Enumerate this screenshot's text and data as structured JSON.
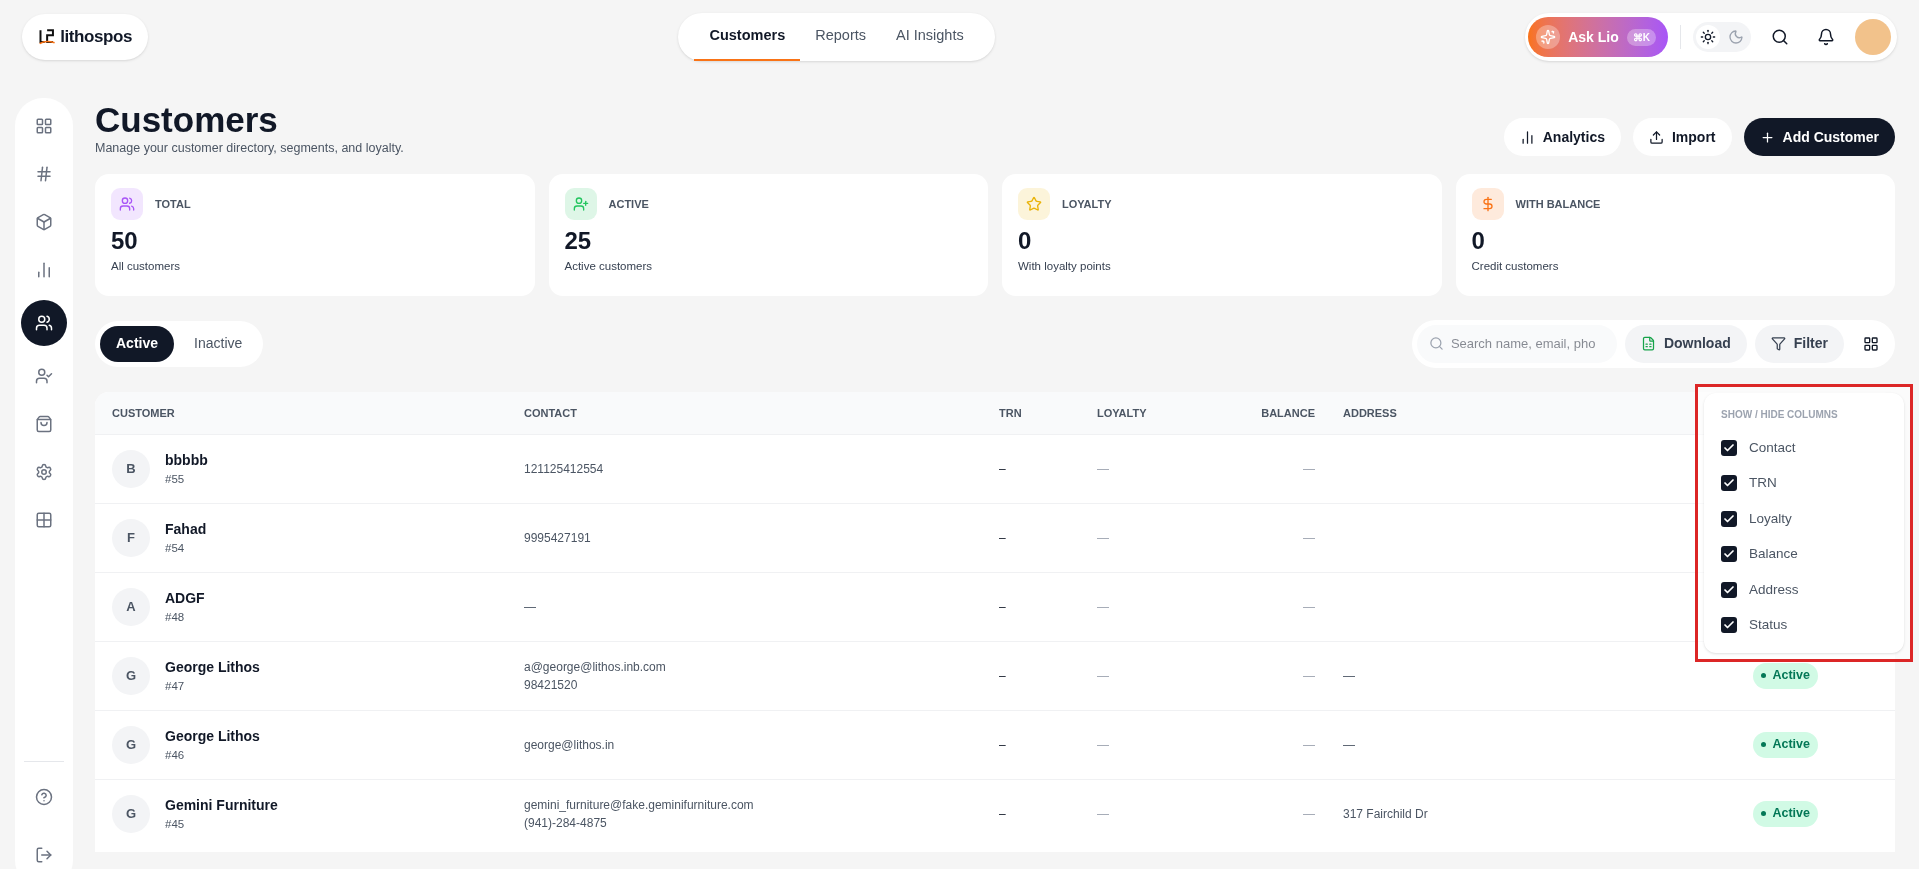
{
  "brand": {
    "name": "lithospos"
  },
  "nav": [
    {
      "label": "Customers",
      "selected": true
    },
    {
      "label": "Reports",
      "selected": false
    },
    {
      "label": "AI Insights",
      "selected": false
    }
  ],
  "assistant": {
    "label": "Ask Lio",
    "shortcut": "⌘K"
  },
  "theme": {
    "dark": false
  },
  "sidebar": {
    "items": [
      {
        "selected": false
      },
      {
        "selected": false
      },
      {
        "selected": false
      },
      {
        "selected": false
      },
      {
        "selected": true
      },
      {
        "selected": false
      },
      {
        "selected": false
      },
      {
        "selected": false
      },
      {
        "selected": false
      }
    ],
    "footer": [
      {
        "selected": false
      },
      {
        "selected": false
      }
    ]
  },
  "page": {
    "title": "Customers",
    "subtitle": "Manage your customer directory, segments, and loyalty.",
    "actions": [
      {
        "label": "Analytics",
        "kind": "secondary"
      },
      {
        "label": "Import",
        "kind": "secondary"
      },
      {
        "label": "Add Customer",
        "kind": "primary"
      }
    ]
  },
  "stats": [
    {
      "label": "TOTAL",
      "value": "50",
      "caption": "All customers",
      "color": "#a855f7"
    },
    {
      "label": "ACTIVE",
      "value": "25",
      "caption": "Active customers",
      "color": "#22c55e"
    },
    {
      "label": "LOYALTY",
      "value": "0",
      "caption": "With loyalty points",
      "color": "#eab308"
    },
    {
      "label": "WITH BALANCE",
      "value": "0",
      "caption": "Credit customers",
      "color": "#f97316"
    }
  ],
  "status_tabs": [
    {
      "label": "Active",
      "selected": true
    },
    {
      "label": "Inactive",
      "selected": false
    }
  ],
  "toolbar": {
    "search": {
      "placeholder": "Search name, email, pho"
    },
    "download": "Download",
    "filter": "Filter"
  },
  "table": {
    "columns": [
      "CUSTOMER",
      "CONTACT",
      "TRN",
      "LOYALTY",
      "BALANCE",
      "ADDRESS"
    ],
    "rows": [
      {
        "initial": "B",
        "name": "bbbbb",
        "id": "#55",
        "contact": [
          "121125412554"
        ],
        "trn": "–",
        "loyalty": "—",
        "balance": "—"
      },
      {
        "initial": "F",
        "name": "Fahad",
        "id": "#54",
        "contact": [
          "9995427191"
        ],
        "trn": "–",
        "loyalty": "—",
        "balance": "—"
      },
      {
        "initial": "A",
        "name": "ADGF",
        "id": "#48",
        "contact": [
          "—"
        ],
        "trn": "–",
        "loyalty": "—",
        "balance": "—"
      },
      {
        "initial": "G",
        "name": "George Lithos",
        "id": "#47",
        "contact": [
          "a@george@lithos.inb.com",
          "98421520"
        ],
        "trn": "–",
        "loyalty": "—",
        "balance": "—",
        "address": "—",
        "status": "Active"
      },
      {
        "initial": "G",
        "name": "George Lithos",
        "id": "#46",
        "contact": [
          "george@lithos.in"
        ],
        "trn": "–",
        "loyalty": "—",
        "balance": "—",
        "address": "—",
        "status": "Active"
      },
      {
        "initial": "G",
        "name": "Gemini Furniture",
        "id": "#45",
        "contact": [
          "gemini_furniture@fake.geminifurniture.com",
          "(941)-284-4875"
        ],
        "trn": "–",
        "loyalty": "—",
        "balance": "—",
        "address": "317 Fairchild Dr",
        "status": "Active"
      }
    ]
  },
  "column_menu": {
    "title": "SHOW / HIDE COLUMNS",
    "items": [
      {
        "label": "Contact",
        "checked": true
      },
      {
        "label": "TRN",
        "checked": true
      },
      {
        "label": "Loyalty",
        "checked": true
      },
      {
        "label": "Balance",
        "checked": true
      },
      {
        "label": "Address",
        "checked": true
      },
      {
        "label": "Status",
        "checked": true
      }
    ]
  }
}
